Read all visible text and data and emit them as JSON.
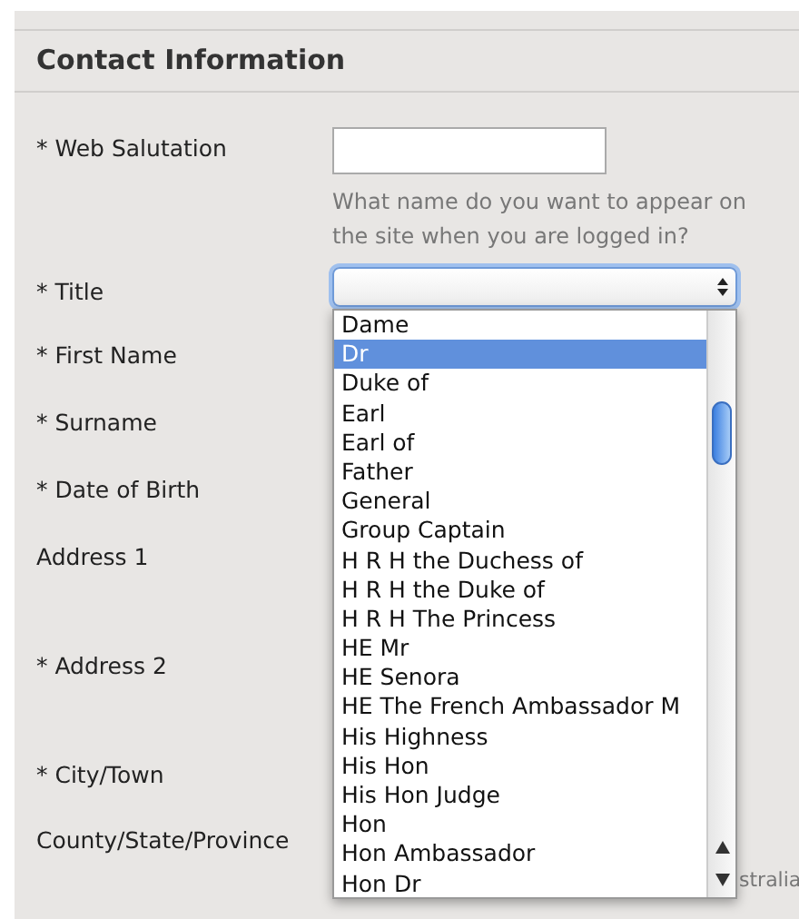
{
  "section_title": "Contact Information",
  "fields": [
    {
      "kind": "text",
      "label": "* Web Salutation",
      "hint": "What name do you want to appear on the site when you are logged in?"
    },
    {
      "kind": "select",
      "label": "* Title"
    },
    {
      "kind": "plain",
      "label": "* First Name"
    },
    {
      "kind": "plain",
      "label": "* Surname"
    },
    {
      "kind": "plain",
      "label": "* Date of Birth"
    },
    {
      "kind": "plain",
      "label": "Address 1"
    },
    {
      "kind": "plain",
      "label": "* Address 2"
    },
    {
      "kind": "plain",
      "label": "* City/Town"
    },
    {
      "kind": "plain",
      "label": "County/State/Province",
      "side_text": "stralia"
    }
  ],
  "title_dropdown": {
    "expanded": true,
    "options": [
      {
        "label": "Dame",
        "selected": false
      },
      {
        "label": "Dr",
        "selected": true
      },
      {
        "label": "Duke of",
        "selected": false
      },
      {
        "label": "Earl",
        "selected": false
      },
      {
        "label": "Earl of",
        "selected": false
      },
      {
        "label": "Father",
        "selected": false
      },
      {
        "label": "General",
        "selected": false
      },
      {
        "label": "Group Captain",
        "selected": false
      },
      {
        "label": "H R H the Duchess of",
        "selected": false
      },
      {
        "label": "H R H the Duke of",
        "selected": false
      },
      {
        "label": "H R H The Princess",
        "selected": false
      },
      {
        "label": "HE Mr",
        "selected": false
      },
      {
        "label": "HE Senora",
        "selected": false
      },
      {
        "label": "HE The French Ambassador M",
        "selected": false
      },
      {
        "label": "His Highness",
        "selected": false
      },
      {
        "label": "His Hon",
        "selected": false
      },
      {
        "label": "His Hon Judge",
        "selected": false
      },
      {
        "label": "Hon",
        "selected": false
      },
      {
        "label": "Hon Ambassador",
        "selected": false
      },
      {
        "label": "Hon Dr",
        "selected": false
      }
    ]
  }
}
